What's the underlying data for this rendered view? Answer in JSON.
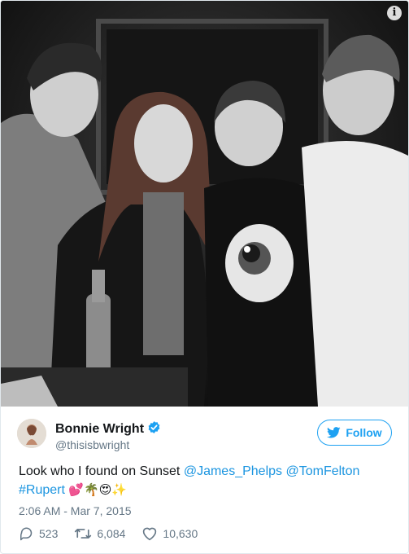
{
  "tweet": {
    "author_name": "Bonnie Wright",
    "author_handle": "@thisisbwright",
    "follow_label": "Follow",
    "text_prefix": "Look who I found on Sunset",
    "mentions": [
      "@James_Phelps",
      "@TomFelton"
    ],
    "hashtag": "#Rupert",
    "emojis": "💕🌴😍✨",
    "timestamp": "2:06 AM - Mar 7, 2015",
    "replies": "523",
    "retweets": "6,084",
    "likes": "10,630"
  },
  "photo": {
    "info_icon": "info-icon",
    "info_label": "i"
  },
  "colors": {
    "link": "#1b95e0",
    "follow": "#1da1f2",
    "muted": "#657786",
    "text": "#14171a"
  }
}
